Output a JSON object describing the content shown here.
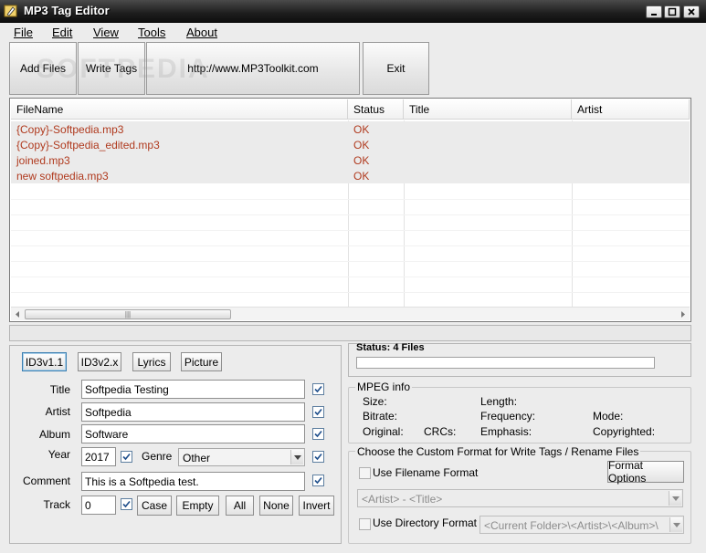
{
  "window": {
    "title": "MP3 Tag Editor"
  },
  "menu": {
    "file": "File",
    "edit": "Edit",
    "view": "View",
    "tools": "Tools",
    "about": "About"
  },
  "toolbar": {
    "add_files": "Add Files",
    "write_tags": "Write Tags",
    "website": "http://www.MP3Toolkit.com",
    "exit": "Exit",
    "watermark": "SOFTPEDIA"
  },
  "file_list": {
    "columns": [
      "FileName",
      "Status",
      "Title",
      "Artist"
    ],
    "rows": [
      {
        "filename": "{Copy}-Softpedia.mp3",
        "status": "OK"
      },
      {
        "filename": "{Copy}-Softpedia_edited.mp3",
        "status": "OK"
      },
      {
        "filename": "joined.mp3",
        "status": "OK"
      },
      {
        "filename": "new softpedia.mp3",
        "status": "OK"
      }
    ],
    "scroll_grip": "|||"
  },
  "tabs": {
    "id3v1": "ID3v1.1",
    "id3v2": "ID3v2.x",
    "lyrics": "Lyrics",
    "picture": "Picture"
  },
  "tags": {
    "title_label": "Title",
    "title_value": "Softpedia Testing",
    "artist_label": "Artist",
    "artist_value": "Softpedia",
    "album_label": "Album",
    "album_value": "Software",
    "year_label": "Year",
    "year_value": "2017",
    "genre_label": "Genre",
    "genre_value": "Other",
    "comment_label": "Comment",
    "comment_value": "This is a Softpedia test.",
    "track_label": "Track",
    "track_value": "0"
  },
  "case_buttons": {
    "case": "Case",
    "empty": "Empty",
    "all": "All",
    "none": "None",
    "invert": "Invert"
  },
  "status": {
    "text": "Status: 4 Files"
  },
  "mpeg": {
    "title": "MPEG info",
    "size": "Size:",
    "length": "Length:",
    "bitrate": "Bitrate:",
    "frequency": "Frequency:",
    "mode": "Mode:",
    "original": "Original:",
    "crcs": "CRCs:",
    "emphasis": "Emphasis:",
    "copyrighted": "Copyrighted:"
  },
  "format": {
    "title": "Choose the Custom Format for Write Tags / Rename Files",
    "use_filename": "Use Filename Format",
    "format_options": "Format Options",
    "filename_pattern": "<Artist> - <Title>",
    "use_directory": "Use Directory Format",
    "directory_pattern": "<Current Folder>\\<Artist>\\<Album>\\"
  }
}
